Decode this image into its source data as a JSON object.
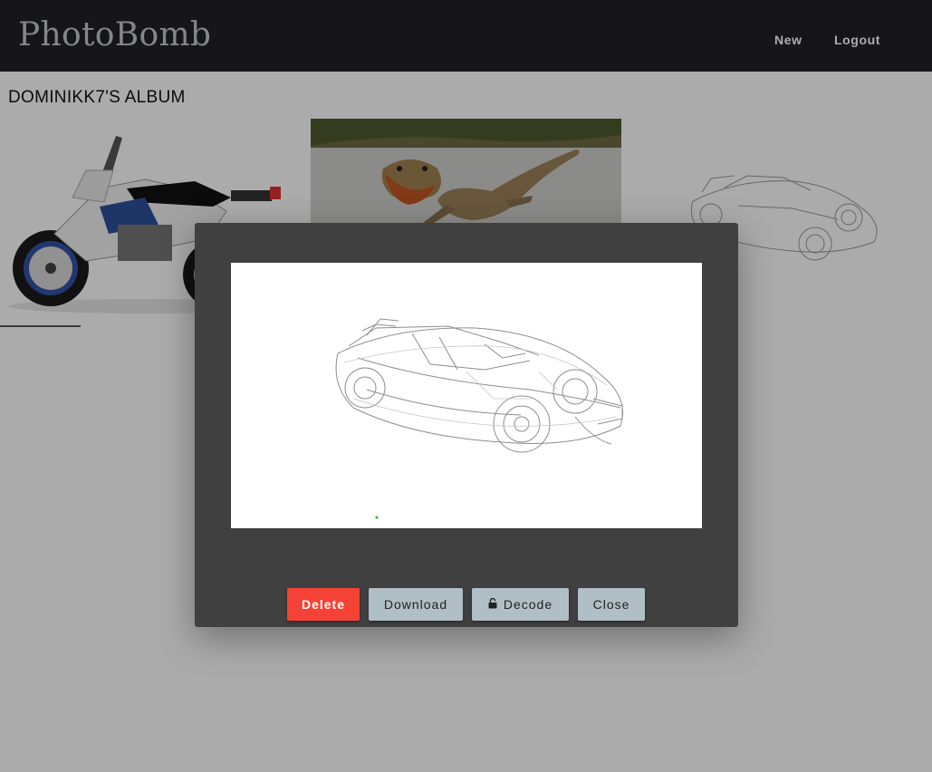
{
  "app": {
    "brand": "PhotoBomb"
  },
  "nav": {
    "new_label": "New",
    "logout_label": "Logout"
  },
  "album": {
    "title": "DOMINIKK7'S ALBUM",
    "thumbnails": [
      {
        "subject": "motorcycle"
      },
      {
        "subject": "bearded dragon lizard"
      },
      {
        "subject": "car sketch"
      }
    ]
  },
  "modal": {
    "image_subject": "car sketch",
    "buttons": {
      "delete_label": "Delete",
      "download_label": "Download",
      "decode_label": "Decode",
      "close_label": "Close"
    },
    "decode_icon": "unlock-icon"
  },
  "colors": {
    "navbar_bg": "#212226",
    "modal_bg": "#404040",
    "delete_bg": "#f44336",
    "secondary_btn_bg": "#b0bec5"
  }
}
